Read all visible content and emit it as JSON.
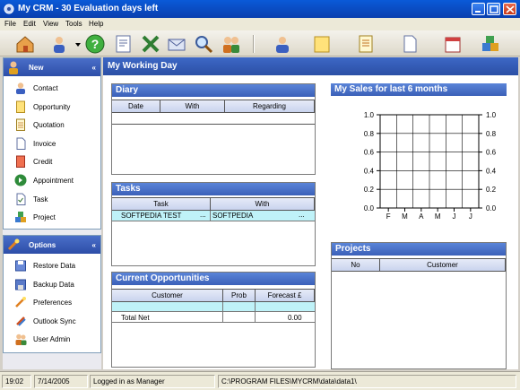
{
  "window": {
    "title": "My CRM - 30 Evaluation days left"
  },
  "menubar": {
    "items": [
      "File",
      "Edit",
      "View",
      "Tools",
      "Help"
    ]
  },
  "sidebar": {
    "new_panel": {
      "title": "New",
      "items": [
        {
          "label": "Contact",
          "icon": "contact-icon"
        },
        {
          "label": "Opportunity",
          "icon": "opportunity-icon"
        },
        {
          "label": "Quotation",
          "icon": "quotation-icon"
        },
        {
          "label": "Invoice",
          "icon": "invoice-icon"
        },
        {
          "label": "Credit",
          "icon": "credit-icon"
        },
        {
          "label": "Appointment",
          "icon": "appointment-icon"
        },
        {
          "label": "Task",
          "icon": "task-icon"
        },
        {
          "label": "Project",
          "icon": "project-icon"
        }
      ]
    },
    "options_panel": {
      "title": "Options",
      "items": [
        {
          "label": "Restore Data",
          "icon": "restore-icon"
        },
        {
          "label": "Backup Data",
          "icon": "backup-icon"
        },
        {
          "label": "Preferences",
          "icon": "preferences-icon"
        },
        {
          "label": "Outlook Sync",
          "icon": "outlook-sync-icon"
        },
        {
          "label": "User Admin",
          "icon": "user-admin-icon"
        }
      ]
    }
  },
  "main": {
    "title": "My Working Day",
    "diary": {
      "title": "Diary",
      "columns": [
        "Date",
        "With",
        "Regarding"
      ]
    },
    "tasks": {
      "title": "Tasks",
      "columns": [
        "Task",
        "With"
      ],
      "rows": [
        {
          "task": "SOFTPEDIA TEST",
          "with": "SOFTPEDIA"
        }
      ]
    },
    "opportunities": {
      "title": "Current Opportunities",
      "columns": [
        "Customer",
        "Prob",
        "Forecast £"
      ],
      "total_label": "Total Net",
      "total_value": "0.00"
    },
    "sales": {
      "title": "My Sales for last 6 months"
    },
    "projects": {
      "title": "Projects",
      "columns": [
        "No",
        "Customer"
      ]
    }
  },
  "chart_data": {
    "type": "line",
    "title": "My Sales for last 6 months",
    "categories": [
      "F",
      "M",
      "A",
      "M",
      "J",
      "J"
    ],
    "yticks": [
      "0.0",
      "0.2",
      "0.4",
      "0.6",
      "0.8",
      "1.0"
    ],
    "ylim": [
      0,
      1
    ],
    "grid": true,
    "series": []
  },
  "statusbar": {
    "time": "19:02",
    "date": "7/14/2005",
    "user": "Logged in as Manager",
    "path": "C:\\PROGRAM FILES\\MYCRM\\data\\data1\\"
  },
  "colors": {
    "header_blue": "#2b4fa5",
    "section_blue": "#3b60b8",
    "selected_row": "#bff2f8"
  }
}
